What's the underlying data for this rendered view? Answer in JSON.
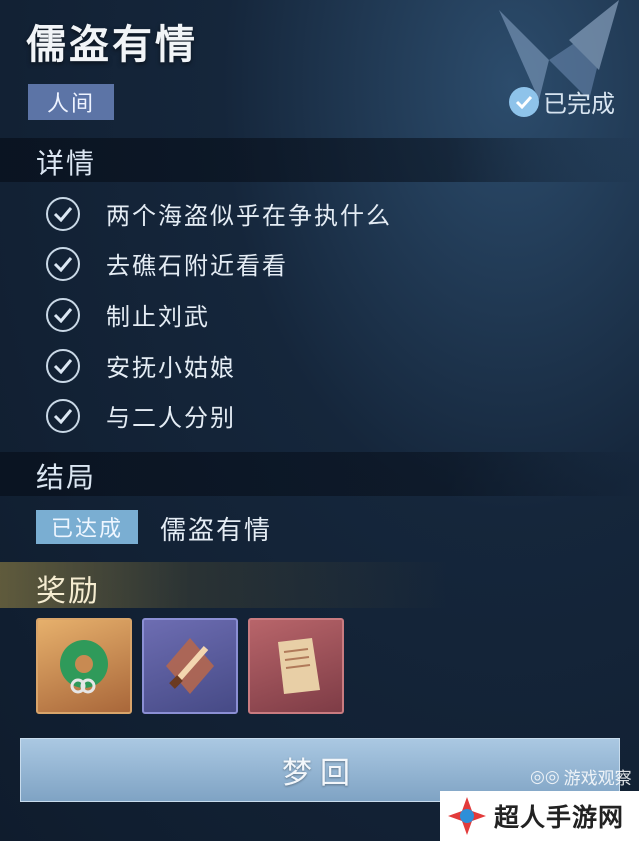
{
  "quest": {
    "title": "儒盗有情",
    "category_tag": "人间",
    "status": "已完成"
  },
  "details": {
    "heading": "详情",
    "tasks": [
      {
        "label": "两个海盗似乎在争执什么",
        "done": true
      },
      {
        "label": "去礁石附近看看",
        "done": true
      },
      {
        "label": "制止刘武",
        "done": true
      },
      {
        "label": "安抚小姑娘",
        "done": true
      },
      {
        "label": "与二人分别",
        "done": true
      }
    ]
  },
  "ending": {
    "heading": "结局",
    "badge": "已达成",
    "name": "儒盗有情"
  },
  "rewards": {
    "heading": "奖励",
    "items": [
      {
        "icon": "jade-pendant-icon",
        "rarity": "gold"
      },
      {
        "icon": "dagger-icon",
        "rarity": "purple"
      },
      {
        "icon": "book-icon",
        "rarity": "red"
      }
    ]
  },
  "action": {
    "button_label": "梦回"
  },
  "watermarks": {
    "top": "游戏观察",
    "bottom": "超人手游网"
  },
  "colors": {
    "tag_bg": "#5c74a6",
    "achieved_bg": "#7aaed2",
    "button_bg": "#8fb2d2",
    "check": "#c9d8e6"
  }
}
